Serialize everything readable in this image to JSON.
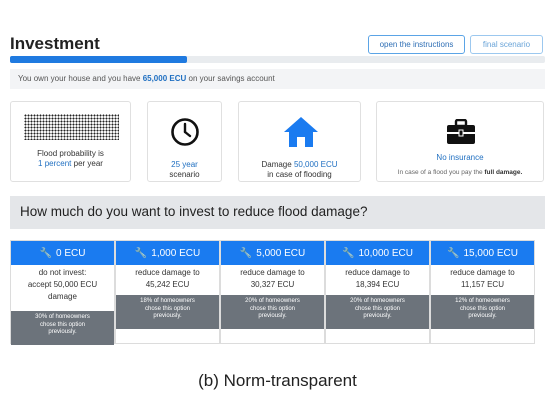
{
  "header": {
    "title": "Investment",
    "instructions_button": "open the instructions",
    "final_button": "final scenario"
  },
  "progress": {
    "fraction": 0.33
  },
  "savings": {
    "prefix": "You own your house and you have ",
    "amount": "65,000 ECU",
    "suffix": " on your savings account"
  },
  "cards": {
    "flood": {
      "line1": "Flood probability is",
      "highlight": "1 percent",
      "suffix": " per year",
      "icon": "dot-grid-icon"
    },
    "scenario": {
      "highlight": "25 year",
      "line2": "scenario",
      "icon": "clock-icon"
    },
    "damage": {
      "prefix": "Damage ",
      "highlight": "50,000 ECU",
      "line2": "in case of flooding",
      "icon": "house-icon"
    },
    "insurance": {
      "highlight": "No insurance",
      "note_prefix": "In case of a flood you pay the ",
      "note_bold": "full damage.",
      "icon": "briefcase-icon"
    }
  },
  "question": "How much do you want to invest to reduce flood damage?",
  "options": [
    {
      "label": "0 ECU",
      "desc": [
        "do not invest:",
        "accept 50,000 ECU",
        "damage"
      ],
      "stat": [
        "30% of homeowners",
        "chose this option",
        "previously."
      ]
    },
    {
      "label": "1,000 ECU",
      "desc": [
        "reduce damage to",
        "45,242 ECU"
      ],
      "stat": [
        "18% of homeowners",
        "chose this option",
        "previously."
      ]
    },
    {
      "label": "5,000 ECU",
      "desc": [
        "reduce damage to",
        "30,327 ECU"
      ],
      "stat": [
        "20% of homeowners",
        "chose this option",
        "previously."
      ]
    },
    {
      "label": "10,000 ECU",
      "desc": [
        "reduce damage to",
        "18,394 ECU"
      ],
      "stat": [
        "20% of homeowners",
        "chose this option",
        "previously."
      ]
    },
    {
      "label": "15,000 ECU",
      "desc": [
        "reduce damage to",
        "11,157 ECU"
      ],
      "stat": [
        "12% of homeowners",
        "chose this option",
        "previously."
      ]
    }
  ],
  "caption": "(b) Norm-transparent",
  "colors": {
    "accent": "#1a7bf0",
    "stat_bg": "#6c737b",
    "highlight_text": "#1f6fc1"
  }
}
